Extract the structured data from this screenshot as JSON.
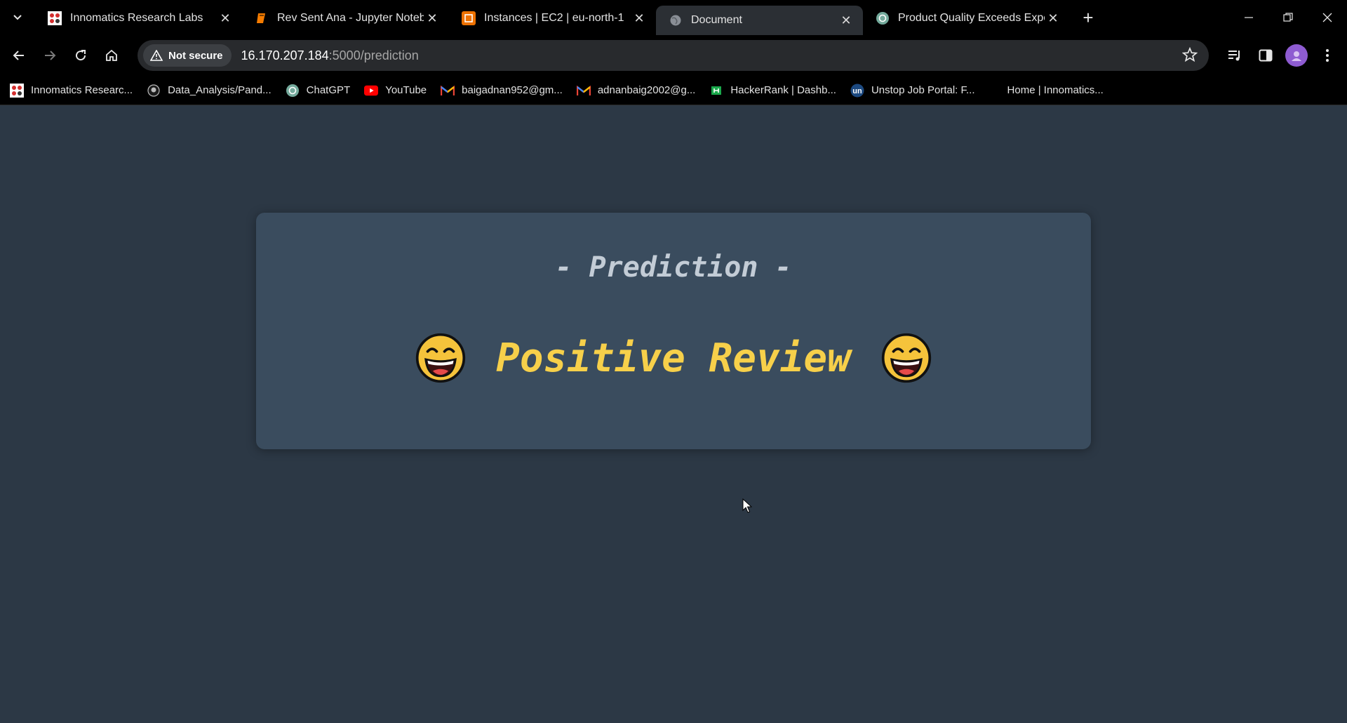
{
  "browser": {
    "tabs": [
      {
        "title": "Innomatics Research Labs",
        "icon": "innomatics-icon",
        "active": false
      },
      {
        "title": "Rev Sent Ana - Jupyter Notebook",
        "icon": "jupyter-icon",
        "active": false
      },
      {
        "title": "Instances | EC2 | eu-north-1",
        "icon": "aws-ec2-icon",
        "active": false
      },
      {
        "title": "Document",
        "icon": "globe-icon",
        "active": true
      },
      {
        "title": "Product Quality Exceeds Expectations",
        "icon": "chatgpt-icon",
        "active": false
      }
    ],
    "security_chip": "Not secure",
    "url_host": "16.170.207.184",
    "url_path": ":5000/prediction",
    "bookmarks": [
      {
        "label": "Innomatics Researc...",
        "icon": "innomatics-icon"
      },
      {
        "label": "Data_Analysis/Pand...",
        "icon": "github-icon"
      },
      {
        "label": "ChatGPT",
        "icon": "chatgpt-icon"
      },
      {
        "label": "YouTube",
        "icon": "youtube-icon"
      },
      {
        "label": "baigadnan952@gm...",
        "icon": "gmail-icon"
      },
      {
        "label": "adnanbaig2002@g...",
        "icon": "gmail-icon"
      },
      {
        "label": "HackerRank | Dashb...",
        "icon": "hackerrank-icon"
      },
      {
        "label": "Unstop Job Portal: F...",
        "icon": "unstop-icon"
      },
      {
        "label": "Home | Innomatics...",
        "icon": ""
      }
    ]
  },
  "page": {
    "heading": "- Prediction -",
    "result": "Positive Review",
    "colors": {
      "background": "#2c3845",
      "card": "#3a4c5e",
      "heading": "#c3ccd6",
      "result": "#f7d04a"
    }
  }
}
